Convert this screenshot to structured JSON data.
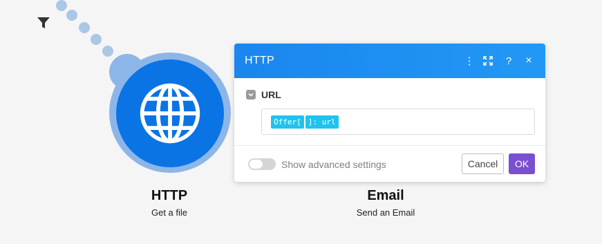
{
  "canvas": {
    "filter_icon": "filter-icon",
    "connector_color": "#a9c8e6"
  },
  "modules": {
    "http": {
      "title": "HTTP",
      "subtitle": "Get a file",
      "icon": "globe-icon",
      "color": "#0b74e5"
    },
    "email": {
      "title": "Email",
      "subtitle": "Send an Email"
    }
  },
  "dialog": {
    "title": "HTTP",
    "header_color": "#1a86ee",
    "header_icons": [
      "more-vertical-icon",
      "expand-icon",
      "help-icon",
      "close-icon"
    ],
    "help_label": "?",
    "close_label": "×",
    "more_label": "⋮",
    "field": {
      "label": "URL",
      "pills": [
        "Offer[",
        "]: url"
      ]
    },
    "advanced_settings_label": "Show advanced settings",
    "advanced_settings_on": false,
    "cancel_label": "Cancel",
    "ok_label": "OK",
    "ok_color": "#7a4fd0"
  }
}
